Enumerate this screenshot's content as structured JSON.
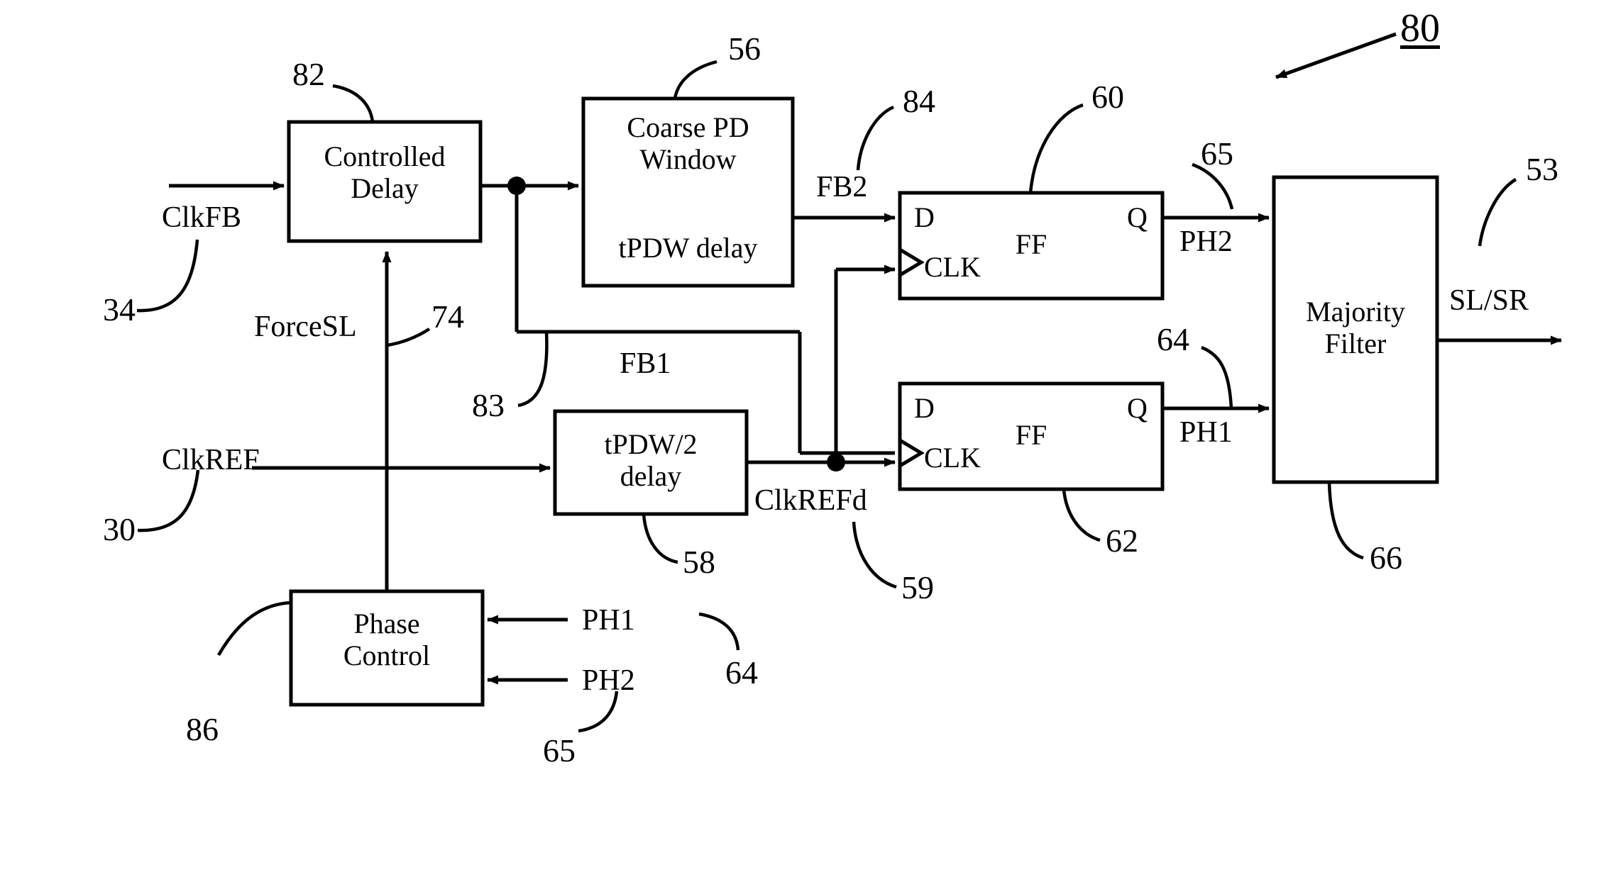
{
  "figure": {
    "number": "80",
    "stroke_color": "#000000",
    "background_color": "#ffffff"
  },
  "blocks": [
    {
      "id": "controlled_delay",
      "label": "Controlled\nDelay",
      "ref": "82"
    },
    {
      "id": "coarse_pd_window",
      "label": "Coarse PD\nWindow",
      "sublabel": "tPDW delay",
      "ref": "56"
    },
    {
      "id": "ff_top",
      "label": "FF",
      "pin_d": "D",
      "pin_q": "Q",
      "pin_clk": "CLK",
      "ref": "60"
    },
    {
      "id": "ff_bottom",
      "label": "FF",
      "pin_d": "D",
      "pin_q": "Q",
      "pin_clk": "CLK",
      "ref": "62"
    },
    {
      "id": "majority_filter",
      "label": "Majority\nFilter",
      "ref": "66"
    },
    {
      "id": "tpdw2_delay",
      "label": "tPDW/2\ndelay",
      "ref": "58"
    },
    {
      "id": "phase_control",
      "label": "Phase\nControl",
      "ref": "86"
    }
  ],
  "signals": {
    "clkfb": "ClkFB",
    "clkfb_ref": "34",
    "clkref": "ClkREF",
    "clkref_ref": "30",
    "forcesl": "ForceSL",
    "forcesl_ref": "74",
    "fb1": "FB1",
    "fb1_ref": "83",
    "fb2": "FB2",
    "fb2_ref": "84",
    "clkrefd": "ClkREFd",
    "clkrefd_ref": "59",
    "ph1_out": "PH1",
    "ph1_out_ref": "64",
    "ph2_out": "PH2",
    "ph2_out_ref": "65",
    "sl_sr": "SL/SR",
    "sl_sr_ref": "53",
    "ph1_in": "PH1",
    "ph1_in_ref": "64",
    "ph2_in": "PH2",
    "ph2_in_ref": "65"
  }
}
